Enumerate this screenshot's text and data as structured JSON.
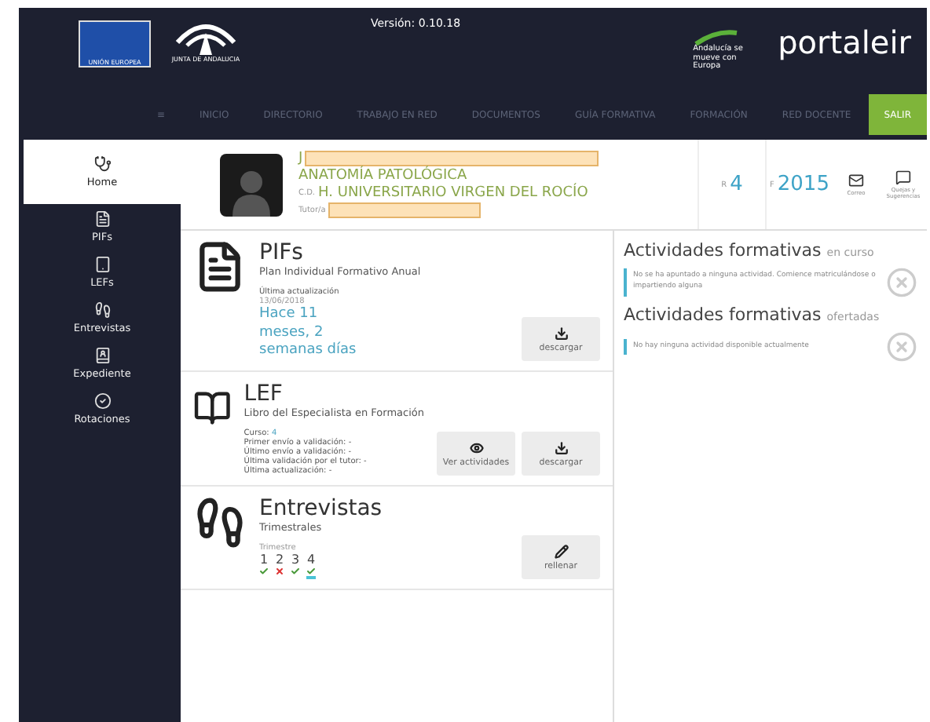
{
  "header": {
    "eu_label": "UNIÓN EUROPEA",
    "junta_label": "JUNTA DE ANDALUCIA",
    "version": "Versión: 0.10.18",
    "andalucia_label": "Andalucía se mueve con Europa",
    "brand": "portaleir"
  },
  "nav": {
    "menu_glyph": "≡",
    "items": [
      {
        "label": "INICIO",
        "selected": false
      },
      {
        "label": "DIRECTORIO",
        "selected": false
      },
      {
        "label": "TRABAJO EN RED",
        "selected": false
      },
      {
        "label": "DOCUMENTOS",
        "selected": false
      },
      {
        "label": "GUÍA FORMATIVA",
        "selected": false
      },
      {
        "label": "FORMACIÓN",
        "selected": false
      },
      {
        "label": "RED DOCENTE",
        "selected": false
      }
    ],
    "logout": "SALIR"
  },
  "sidebar": {
    "items": [
      {
        "label": "Home",
        "kind": "home",
        "selected": true
      },
      {
        "label": "PIFs",
        "kind": "pifs",
        "selected": false
      },
      {
        "label": "LEFs",
        "kind": "lefs",
        "selected": false
      },
      {
        "label": "Entrevistas",
        "kind": "entrevistas",
        "selected": false
      },
      {
        "label": "Expediente",
        "kind": "expediente",
        "selected": false
      },
      {
        "label": "Rotaciones",
        "kind": "rotaciones",
        "selected": false
      }
    ]
  },
  "profile": {
    "name_initial": "J",
    "specialty": "ANATOMÍA PATOLÓGICA",
    "center_prefix": "C.D.",
    "center": "H. UNIVERSITARIO VIRGEN DEL ROCÍO",
    "tutor_label": "Tutor/a",
    "stats": [
      {
        "prefix": "R",
        "value": "4"
      },
      {
        "prefix": "F",
        "value": "2015"
      }
    ],
    "actions": [
      {
        "label": "Correo",
        "kind": "mail"
      },
      {
        "label": "Quejas y Sugerencias",
        "kind": "message"
      }
    ]
  },
  "cards": [
    {
      "kind": "pifs",
      "title": "PIFs",
      "subtitle": "Plan Individual Formativo Anual",
      "update_label": "Última actualización",
      "update_date": "13/06/2018",
      "ago": [
        "Hace 11",
        "meses, 2",
        "semanas días"
      ],
      "buttons": [
        {
          "label": "descargar",
          "kind": "download"
        }
      ]
    },
    {
      "kind": "lef",
      "title": "LEF",
      "subtitle": "Libro del Especialista en Formación",
      "course_label": "Curso:",
      "course": "4",
      "lines": [
        "Primer envío a validación: -",
        "Último envío a validación: -",
        "Última validación por el tutor: -",
        "Última actualización: -"
      ],
      "buttons": [
        {
          "label": "Ver actividades",
          "kind": "view"
        },
        {
          "label": "descargar",
          "kind": "download"
        }
      ]
    },
    {
      "kind": "entrevistas",
      "title": "Entrevistas",
      "subtitle": "Trimestrales",
      "quarter_label": "Trimestre",
      "quarters": [
        {
          "label": "1",
          "done": true,
          "selected": false
        },
        {
          "label": "2",
          "done": false,
          "selected": false
        },
        {
          "label": "3",
          "done": true,
          "selected": false
        },
        {
          "label": "4",
          "done": true,
          "selected": true
        }
      ],
      "buttons": [
        {
          "label": "rellenar",
          "kind": "edit"
        }
      ]
    }
  ],
  "activities": [
    {
      "title": "Actividades formativas",
      "suffix": "en curso",
      "message": "No se ha apuntado a ninguna actividad. Comience matriculándose o impartiendo alguna"
    },
    {
      "title": "Actividades formativas",
      "suffix": "ofertadas",
      "message": "No hay ninguna actividad disponible actualmente"
    }
  ]
}
